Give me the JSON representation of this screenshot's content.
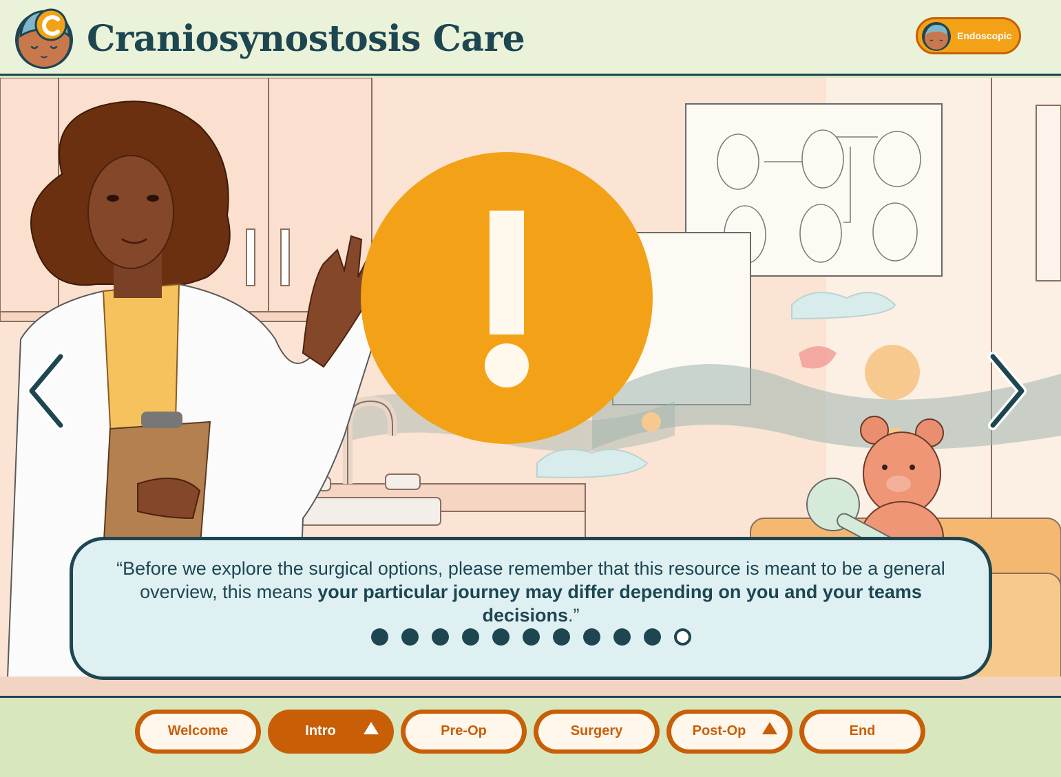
{
  "header": {
    "title": "Craniosynostosis Care",
    "mode_toggle": {
      "label": "Endoscopic"
    }
  },
  "colors": {
    "navy": "#1d4651",
    "orange": "#f3a218",
    "dark_orange": "#c85e06",
    "header_bg": "#eaf3da",
    "footer_bg": "#d8e7bd",
    "dialog_bg": "#dff0f3"
  },
  "scene": {
    "prev_icon": "chevron-left-icon",
    "next_icon": "chevron-right-icon",
    "alert_icon": "exclamation-icon"
  },
  "dialog": {
    "quote_open": "“Before we explore the surgical options, please remember that this resource is meant to be a general overview, this means ",
    "quote_bold": "your particular journey may differ depending on you and your teams decisions",
    "quote_close": ".”",
    "progress": {
      "total": 11,
      "current": 11
    }
  },
  "nav": {
    "tabs": [
      {
        "label": "Welcome",
        "active": false,
        "has_arrow": false
      },
      {
        "label": "Intro",
        "active": true,
        "has_arrow": true
      },
      {
        "label": "Pre-Op",
        "active": false,
        "has_arrow": false
      },
      {
        "label": "Surgery",
        "active": false,
        "has_arrow": false
      },
      {
        "label": "Post-Op",
        "active": false,
        "has_arrow": true
      },
      {
        "label": "End",
        "active": false,
        "has_arrow": false
      }
    ]
  }
}
